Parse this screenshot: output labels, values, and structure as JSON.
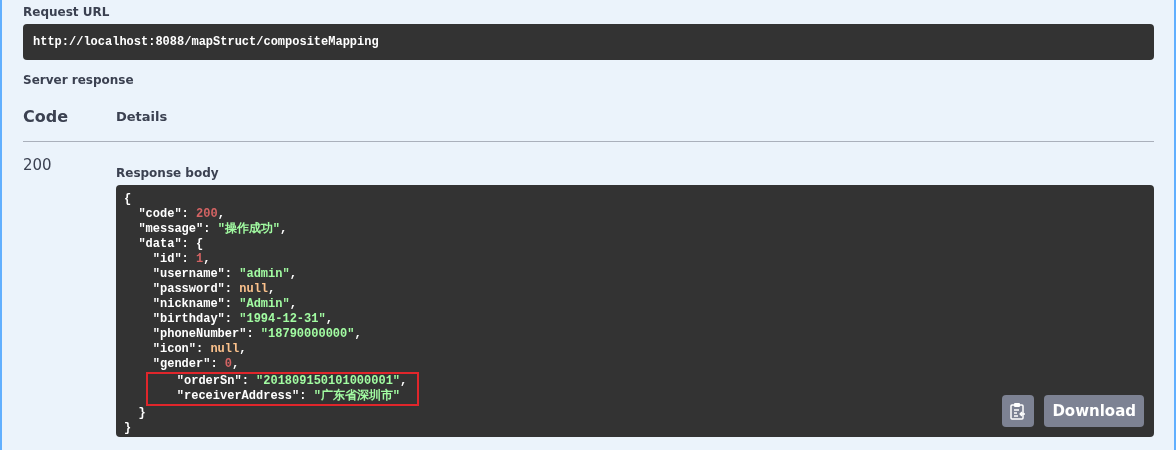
{
  "request_url": {
    "label": "Request URL",
    "value": "http://localhost:8088/mapStruct/compositeMapping"
  },
  "server_response": {
    "label": "Server response"
  },
  "table": {
    "columns": [
      "Code",
      "Details"
    ],
    "rows": [
      {
        "code": "200",
        "body_label": "Response body",
        "body_lines": [
          {
            "marked": false,
            "tokens": [
              {
                "kind": "punct",
                "text": "{"
              }
            ]
          },
          {
            "marked": false,
            "tokens": [
              {
                "kind": "key",
                "text": "  \"code\""
              },
              {
                "kind": "punct",
                "text": ": "
              },
              {
                "kind": "number",
                "text": "200"
              },
              {
                "kind": "punct",
                "text": ","
              }
            ]
          },
          {
            "marked": false,
            "tokens": [
              {
                "kind": "key",
                "text": "  \"message\""
              },
              {
                "kind": "punct",
                "text": ": "
              },
              {
                "kind": "string",
                "text": "\"操作成功\""
              },
              {
                "kind": "punct",
                "text": ","
              }
            ]
          },
          {
            "marked": false,
            "tokens": [
              {
                "kind": "key",
                "text": "  \"data\""
              },
              {
                "kind": "punct",
                "text": ": {"
              }
            ]
          },
          {
            "marked": false,
            "tokens": [
              {
                "kind": "key",
                "text": "    \"id\""
              },
              {
                "kind": "punct",
                "text": ": "
              },
              {
                "kind": "number",
                "text": "1"
              },
              {
                "kind": "punct",
                "text": ","
              }
            ]
          },
          {
            "marked": false,
            "tokens": [
              {
                "kind": "key",
                "text": "    \"username\""
              },
              {
                "kind": "punct",
                "text": ": "
              },
              {
                "kind": "string",
                "text": "\"admin\""
              },
              {
                "kind": "punct",
                "text": ","
              }
            ]
          },
          {
            "marked": false,
            "tokens": [
              {
                "kind": "key",
                "text": "    \"password\""
              },
              {
                "kind": "punct",
                "text": ": "
              },
              {
                "kind": "null",
                "text": "null"
              },
              {
                "kind": "punct",
                "text": ","
              }
            ]
          },
          {
            "marked": false,
            "tokens": [
              {
                "kind": "key",
                "text": "    \"nickname\""
              },
              {
                "kind": "punct",
                "text": ": "
              },
              {
                "kind": "string",
                "text": "\"Admin\""
              },
              {
                "kind": "punct",
                "text": ","
              }
            ]
          },
          {
            "marked": false,
            "tokens": [
              {
                "kind": "key",
                "text": "    \"birthday\""
              },
              {
                "kind": "punct",
                "text": ": "
              },
              {
                "kind": "string",
                "text": "\"1994-12-31\""
              },
              {
                "kind": "punct",
                "text": ","
              }
            ]
          },
          {
            "marked": false,
            "tokens": [
              {
                "kind": "key",
                "text": "    \"phoneNumber\""
              },
              {
                "kind": "punct",
                "text": ": "
              },
              {
                "kind": "string",
                "text": "\"18790000000\""
              },
              {
                "kind": "punct",
                "text": ","
              }
            ]
          },
          {
            "marked": false,
            "tokens": [
              {
                "kind": "key",
                "text": "    \"icon\""
              },
              {
                "kind": "punct",
                "text": ": "
              },
              {
                "kind": "null",
                "text": "null"
              },
              {
                "kind": "punct",
                "text": ","
              }
            ]
          },
          {
            "marked": false,
            "tokens": [
              {
                "kind": "key",
                "text": "    \"gender\""
              },
              {
                "kind": "punct",
                "text": ": "
              },
              {
                "kind": "number",
                "text": "0"
              },
              {
                "kind": "punct",
                "text": ","
              }
            ]
          },
          {
            "marked": true,
            "tokens": [
              {
                "kind": "key",
                "text": "    \"orderSn\""
              },
              {
                "kind": "punct",
                "text": ": "
              },
              {
                "kind": "string",
                "text": "\"201809150101000001\""
              },
              {
                "kind": "punct",
                "text": ","
              }
            ]
          },
          {
            "marked": true,
            "tokens": [
              {
                "kind": "key",
                "text": "    \"receiverAddress\""
              },
              {
                "kind": "punct",
                "text": ": "
              },
              {
                "kind": "string",
                "text": "\"广东省深圳市\""
              }
            ]
          },
          {
            "marked": false,
            "tokens": [
              {
                "kind": "punct",
                "text": "  }"
              }
            ]
          },
          {
            "marked": false,
            "tokens": [
              {
                "kind": "punct",
                "text": "}"
              }
            ]
          }
        ],
        "download_label": "Download"
      }
    ]
  }
}
